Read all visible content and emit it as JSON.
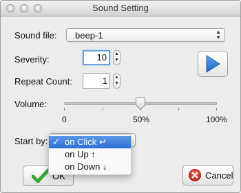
{
  "window": {
    "title": "Sound Setting"
  },
  "sound_file": {
    "label": "Sound file:",
    "value": "beep-1"
  },
  "severity": {
    "label": "Severity:",
    "value": "10"
  },
  "repeat_count": {
    "label": "Repeat Count:",
    "value": "1"
  },
  "volume": {
    "label": "Volume:",
    "tick_labels": [
      "0",
      "50%",
      "100%"
    ],
    "level": 0.5
  },
  "start_by": {
    "label": "Start by:",
    "menu_items": [
      {
        "check": "✓",
        "label": "on Click ↵",
        "selected": true
      },
      {
        "check": "",
        "label": "on Up ↑",
        "selected": false
      },
      {
        "check": "",
        "label": "on Down ↓",
        "selected": false
      }
    ]
  },
  "buttons": {
    "ok_label": "OK",
    "cancel_label": "Cancel"
  },
  "icons": {
    "play": "play-icon",
    "ok": "checkmark-icon",
    "cancel": "cancel-x-icon"
  },
  "colors": {
    "play_blue": "#2f7fd6",
    "ok_green": "#3aa53a",
    "cancel_red": "#d83a2e",
    "selection": "#3a7bdc"
  }
}
